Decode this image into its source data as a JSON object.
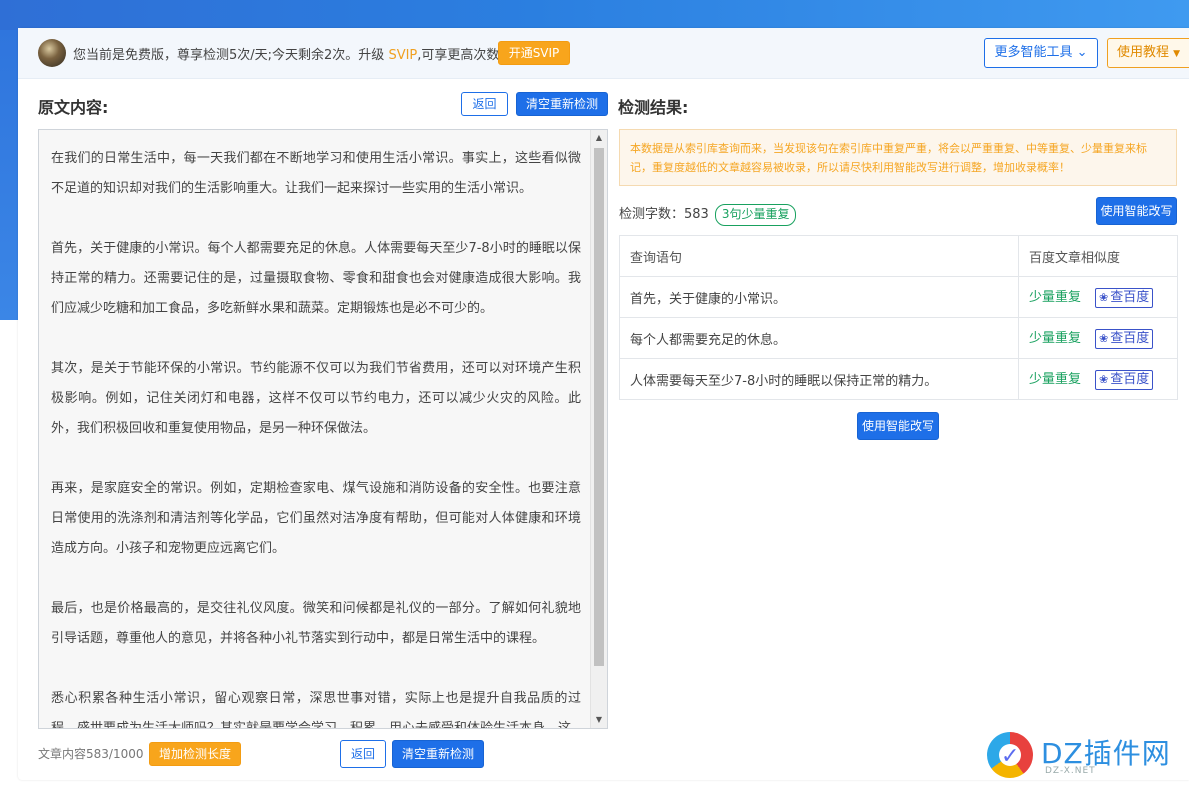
{
  "topbar": {
    "message": "您当前是免费版，尊享检测5次/天;今天剩余2次。升级 ",
    "svip": "SVIP",
    "message_after": ",可享更高次数",
    "open_svip": "开通SVIP",
    "more_tools": "更多智能工具",
    "tutorial": "使用教程"
  },
  "left": {
    "title": "原文内容:",
    "back": "返回",
    "clear_redetect": "清空重新检测",
    "paragraphs": [
      "在我们的日常生活中，每一天我们都在不断地学习和使用生活小常识。事实上，这些看似微不足道的知识却对我们的生活影响重大。让我们一起来探讨一些实用的生活小常识。",
      "首先，关于健康的小常识。每个人都需要充足的休息。人体需要每天至少7-8小时的睡眠以保持正常的精力。还需要记住的是，过量摄取食物、零食和甜食也会对健康造成很大影响。我们应减少吃糖和加工食品，多吃新鲜水果和蔬菜。定期锻炼也是必不可少的。",
      "其次，是关于节能环保的小常识。节约能源不仅可以为我们节省费用，还可以对环境产生积极影响。例如，记住关闭灯和电器，这样不仅可以节约电力，还可以减少火灾的风险。此外，我们积极回收和重复使用物品，是另一种环保做法。",
      "再来，是家庭安全的常识。例如，定期检查家电、煤气设施和消防设备的安全性。也要注意日常使用的洗涤剂和清洁剂等化学品，它们虽然对洁净度有帮助，但可能对人体健康和环境造成方向。小孩子和宠物更应远离它们。",
      "最后，也是价格最高的，是交往礼仪风度。微笑和问候都是礼仪的一部分。了解如何礼貌地引导话题，尊重他人的意见，并将各种小礼节落实到行动中，都是日常生活中的课程。",
      "悉心积累各种生活小常识，留心观察日常，深思世事对错，实际上也是提升自我品质的过程。盛世要成为生活大师吗？其实就是要学会学习、积累、用心去感受和体验生活本身。这"
    ],
    "footer_count": "文章内容583/1000",
    "increase_length": "增加检测长度",
    "footer_back": "返回",
    "footer_clear": "清空重新检测"
  },
  "right": {
    "title": "检测结果:",
    "notice": "本数据是从索引库查询而来，当发现该句在索引库中重复严重，将会以严重重复、中等重复、少量重复来标记，重复度越低的文章越容易被收录，所以请尽快利用智能改写进行调整，增加收录概率！",
    "stat_label": "检测字数：583",
    "stat_badge": "3句少量重复",
    "use_ai_top": "使用智能改写",
    "table": {
      "headers": [
        "查询语句",
        "百度文章相似度"
      ],
      "rows": [
        {
          "sentence": "首先，关于健康的小常识。",
          "status": "少量重复",
          "action": "查百度"
        },
        {
          "sentence": "每个人都需要充足的休息。",
          "status": "少量重复",
          "action": "查百度"
        },
        {
          "sentence": "人体需要每天至少7-8小时的睡眠以保持正常的精力。",
          "status": "少量重复",
          "action": "查百度"
        }
      ]
    },
    "use_ai_bottom": "使用智能改写"
  },
  "watermark": {
    "text": "DZ插件网",
    "sub": "DZ-X.NET"
  },
  "colors": {
    "brand_blue": "#1e6fe8",
    "orange": "#f8a51c",
    "green": "#19a15f",
    "notice_text": "#f5a623"
  }
}
